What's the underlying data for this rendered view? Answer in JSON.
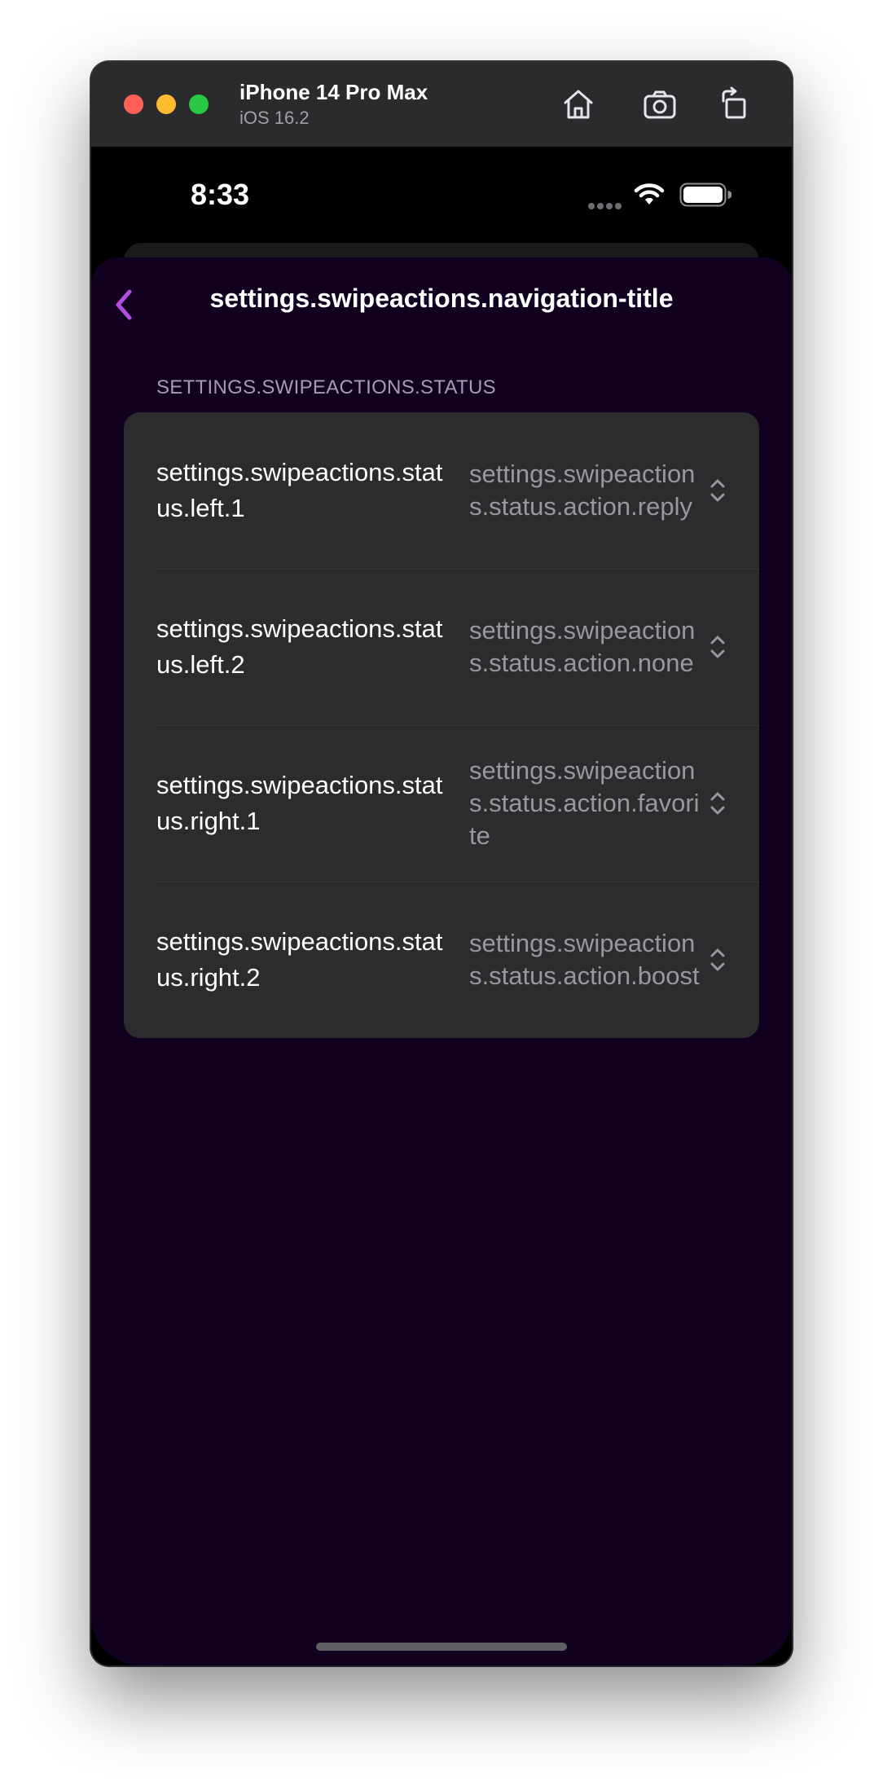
{
  "simulator": {
    "device_name": "iPhone 14 Pro Max",
    "os_version": "iOS 16.2",
    "toolbar_icons": [
      "home-icon",
      "screenshot-icon",
      "rotate-icon"
    ]
  },
  "status_bar": {
    "time": "8:33",
    "icons": [
      "cellular-dots-icon",
      "wifi-icon",
      "battery-icon"
    ]
  },
  "nav": {
    "back_icon": "chevron-left-icon",
    "title": "settings.swipeactions.navigation-title"
  },
  "section": {
    "header": "SETTINGS.SWIPEACTIONS.STATUS",
    "rows": [
      {
        "label": "settings.swipeactions.status.left.1",
        "value": "settings.swipeactions.status.action.reply"
      },
      {
        "label": "settings.swipeactions.status.left.2",
        "value": "settings.swipeactions.status.action.none"
      },
      {
        "label": "settings.swipeactions.status.right.1",
        "value": "settings.swipeactions.status.action.favorite"
      },
      {
        "label": "settings.swipeactions.status.right.2",
        "value": "settings.swipeactions.status.action.boost"
      }
    ]
  },
  "colors": {
    "accent": "#b44ee0",
    "background": "#11001f",
    "cell": "#2c2c2e"
  }
}
